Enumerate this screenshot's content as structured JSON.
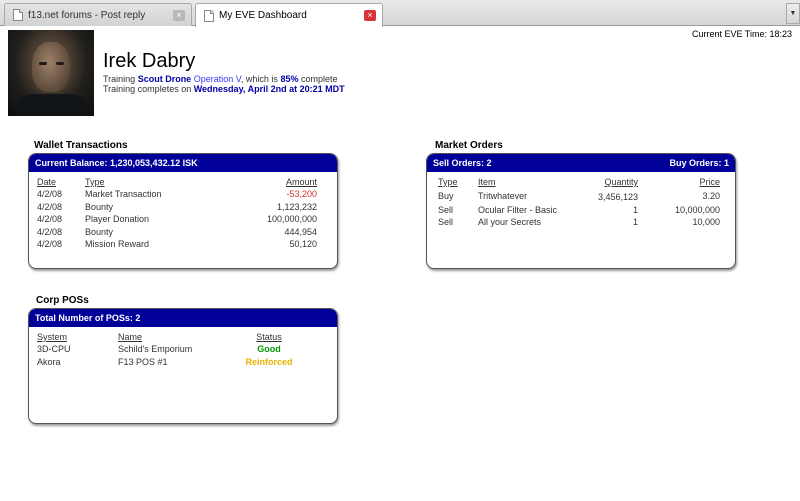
{
  "tabs": [
    {
      "title": "f13.net forums - Post reply",
      "close_label": "×"
    },
    {
      "title": "My EVE Dashboard",
      "close_label": "×"
    }
  ],
  "tab_dropdown_label": "▼",
  "eve_time": "Current EVE Time: 18:23",
  "character": {
    "name": "Irek Dabry",
    "training_prefix": "Training ",
    "skill_name": "Scout Drone",
    "skill_level": "Operation V",
    "training_mid": ", which is ",
    "percent": "85%",
    "training_suffix": " complete",
    "completes_prefix": "Training completes on ",
    "completes_date": "Wednesday, April 2nd at 20:21 MDT"
  },
  "wallet": {
    "title": "Wallet Transactions",
    "balance": "Current Balance: 1,230,053,432.12 ISK",
    "headers": {
      "date": "Date",
      "type": "Type",
      "amount": "Amount"
    },
    "rows": [
      {
        "date": "4/2/08",
        "type": "Market Transaction",
        "amount": "-53,200"
      },
      {
        "date": "4/2/08",
        "type": "Bounty",
        "amount": "1,123,232"
      },
      {
        "date": "4/2/08",
        "type": "Player Donation",
        "amount": "100,000,000"
      },
      {
        "date": "4/2/08",
        "type": "Bounty",
        "amount": "444,954"
      },
      {
        "date": "4/2/08",
        "type": "Mission Reward",
        "amount": "50,120"
      }
    ]
  },
  "market": {
    "title": "Market Orders",
    "sell_orders": "Sell Orders: 2",
    "buy_orders": "Buy Orders: 1",
    "headers": {
      "type": "Type",
      "item": "Item",
      "quantity": "Quantity",
      "price": "Price"
    },
    "rows": [
      {
        "type": "Buy",
        "item": "Tritwhatever",
        "quantity": "3,456,123",
        "price": "3.20"
      },
      {
        "type": "Sell",
        "item": "Ocular Filter - Basic",
        "quantity": "1",
        "price": "10,000,000"
      },
      {
        "type": "Sell",
        "item": "All your Secrets",
        "quantity": "1",
        "price": "10,000"
      }
    ]
  },
  "pos": {
    "title": "Corp POSs",
    "total": "Total Number of POSs: 2",
    "headers": {
      "system": "System",
      "name": "Name",
      "status": "Status"
    },
    "rows": [
      {
        "system": "3D-CPU",
        "name": "Schild's Emporium",
        "status": "Good"
      },
      {
        "system": "Akora",
        "name": "F13 POS #1",
        "status": "Reinforced"
      }
    ]
  }
}
